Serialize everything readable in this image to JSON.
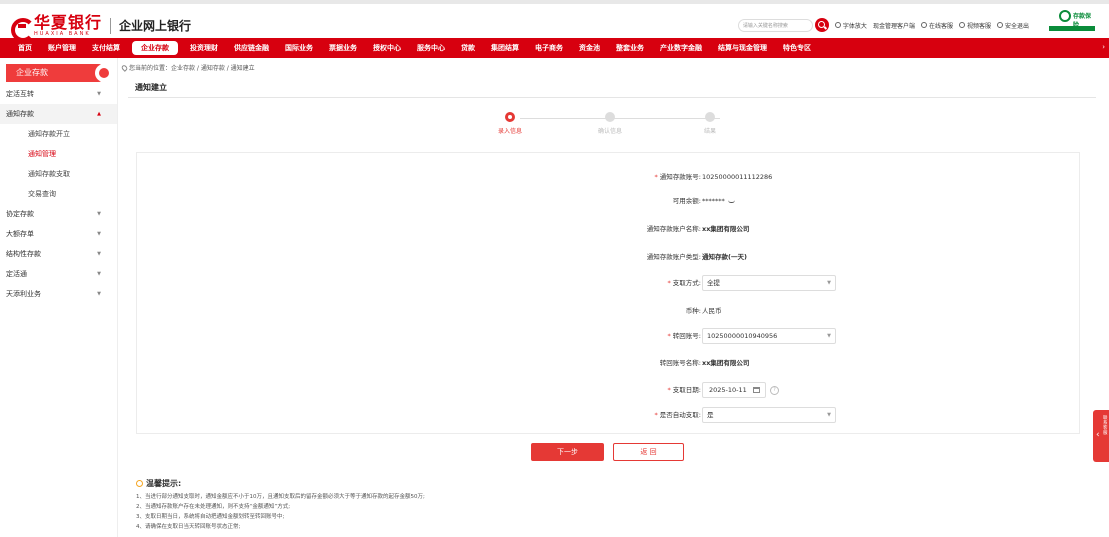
{
  "header": {
    "bank_name": "华夏银行",
    "bank_name_en": "HUAXIA BANK",
    "system_name": "企业网上银行",
    "search_placeholder": "请输入关键名称搜索",
    "tools": [
      "字体放大",
      "现金管理客户端",
      "在线客服",
      "视频客服",
      "安全退出"
    ],
    "partner_logo_text": "存款保险"
  },
  "nav": {
    "items": [
      "首页",
      "账户管理",
      "支付结算",
      "企业存款",
      "投资理财",
      "供应链金融",
      "国际业务",
      "票据业务",
      "授权中心",
      "服务中心",
      "贷款",
      "集团结算",
      "电子商务",
      "资金池",
      "整套业务",
      "产业数字金融",
      "结算与现金管理",
      "特色专区"
    ],
    "active_index": 3,
    "more_glyph": "›"
  },
  "sidebar": {
    "header": "企业存款",
    "items": [
      {
        "label": "定活互转",
        "expandable": true
      },
      {
        "label": "通知存款",
        "expandable": true,
        "open": true,
        "children": [
          "通知存款开立",
          "通知管理",
          "通知存款支取",
          "交易查询"
        ],
        "active_child": 1
      },
      {
        "label": "协定存款",
        "expandable": true
      },
      {
        "label": "大额存单",
        "expandable": true
      },
      {
        "label": "结构性存款",
        "expandable": true
      },
      {
        "label": "定活通",
        "expandable": true
      },
      {
        "label": "天添利业务",
        "expandable": true
      }
    ],
    "arrow_down": "▼",
    "arrow_up": "▲"
  },
  "breadcrumb": "您当前的位置：企业存款 / 通知存款 / 通知建立",
  "page_title": "通知建立",
  "steps": [
    {
      "label": "录入信息",
      "active": true
    },
    {
      "label": "确认信息",
      "active": false
    },
    {
      "label": "结果",
      "active": false
    }
  ],
  "form": {
    "fields": {
      "account_no": {
        "label": "通知存款账号:",
        "required": true,
        "value": "10250000011112286"
      },
      "available_balance": {
        "label": "可用余额:",
        "value": "*******"
      },
      "account_name": {
        "label": "通知存款账户名称:",
        "value": "xx集团有限公司"
      },
      "account_type": {
        "label": "通知存款账户类型:",
        "value": "通知存款(一天)"
      },
      "withdraw_method": {
        "label": "支取方式:",
        "required": true,
        "value": "全提"
      },
      "currency": {
        "label": "币种:",
        "value": "人民币"
      },
      "transfer_account": {
        "label": "转回账号:",
        "required": true,
        "value": "10250000010940956"
      },
      "transfer_account_name": {
        "label": "转回账号名称:",
        "value": "xx集团有限公司"
      },
      "withdraw_date": {
        "label": "支取日期:",
        "required": true,
        "value": "2025-10-11"
      },
      "auto_withdraw": {
        "label": "是否自动支取:",
        "required": true,
        "value": "是"
      }
    },
    "required_mark": "*",
    "caret": "▼",
    "help_glyph": "?"
  },
  "buttons": {
    "next": "下一步",
    "back": "返 回"
  },
  "tips": {
    "title": "温馨提示:",
    "items": [
      "1、当进行部分通知支取时，通知金额应不小于10万，且通知支取后的留存金额必须大于等于通知存款的起存金额50万;",
      "2、当通知存款账户存在未处理通知，则不支持“金额通知”方式;",
      "3、支取日期当日，系统将自动把通知金额划转至转回账号中;",
      "4、请确保在支取日当天转回账号状态正常;"
    ]
  },
  "float_tab": {
    "chevron": "‹",
    "text": "联系客服"
  }
}
